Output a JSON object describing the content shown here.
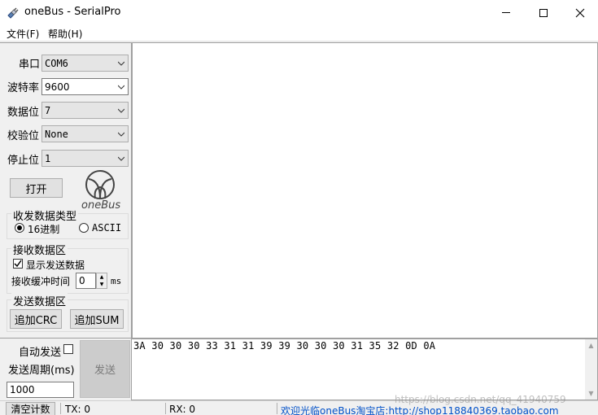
{
  "window": {
    "title": "oneBus - SerialPro",
    "icon": "serial-plug-icon"
  },
  "menu": {
    "file": "文件(F)",
    "help": "帮助(H)"
  },
  "serial": {
    "port_label": "串口",
    "port_value": "COM6",
    "baud_label": "波特率",
    "baud_value": "9600",
    "databits_label": "数据位",
    "databits_value": "7",
    "parity_label": "校验位",
    "parity_value": "None",
    "stopbits_label": "停止位",
    "stopbits_value": "1",
    "open_button": "打开"
  },
  "logo": {
    "text": "oneBus"
  },
  "data_type": {
    "title": "收发数据类型",
    "hex_label": "16进制",
    "ascii_label": "ASCII",
    "selected": "16进制"
  },
  "recv_group": {
    "title": "接收数据区",
    "show_send_label": "显示发送数据",
    "show_send_checked": true,
    "buffer_label": "接收缓冲时间",
    "buffer_value": "0",
    "buffer_unit": "ms"
  },
  "send_group": {
    "title": "发送数据区",
    "add_crc": "追加CRC",
    "add_sum": "追加SUM"
  },
  "send": {
    "auto_label": "自动发送",
    "auto_checked": false,
    "period_label": "发送周期(ms)",
    "period_value": "1000",
    "send_button": "发送",
    "content": "3A 30 30 30 33 31 31 39 39 30 30 30 31 35 32 0D 0A"
  },
  "status": {
    "clear_button": "清空计数",
    "tx": "TX: 0",
    "rx": "RX: 0",
    "link_text": "欢迎光临oneBus淘宝店:http://shop118840369.taobao.com",
    "watermark": "https://blog.csdn.net/qq_41940759"
  }
}
